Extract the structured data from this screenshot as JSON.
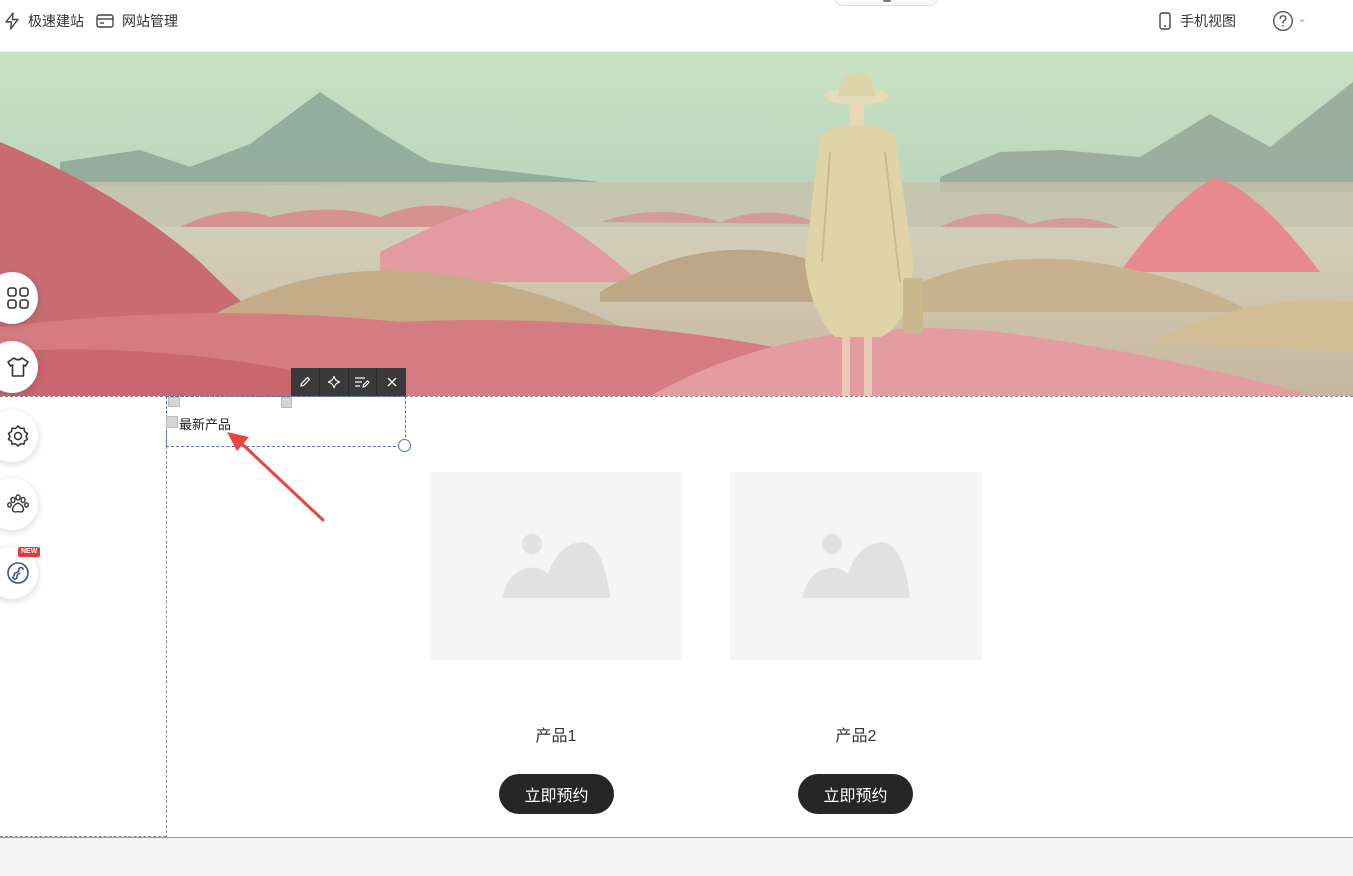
{
  "topbar": {
    "quick_build": "极速建站",
    "site_manage": "网站管理",
    "mobile_view": "手机视图"
  },
  "selected_module": {
    "text": "最新产品"
  },
  "products": [
    {
      "name": "产品1",
      "button": "立即预约"
    },
    {
      "name": "产品2",
      "button": "立即预约"
    }
  ],
  "left_tools": {
    "new_badge": "NEW"
  },
  "colors": {
    "accent": "#4a6fd0",
    "button_dark": "#262626",
    "arrow": "#e8453c"
  }
}
